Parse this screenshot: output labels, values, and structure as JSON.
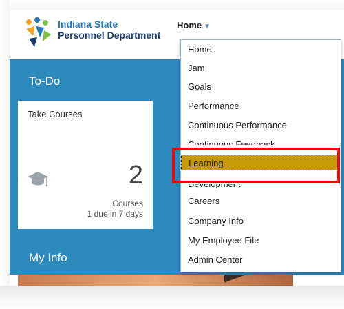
{
  "header": {
    "org_line1": "Indiana State",
    "org_line2": "Personnel Department",
    "home_label": "Home",
    "home_caret": "▼"
  },
  "todo": {
    "title": "To-Do",
    "card": {
      "title": "Take Courses",
      "icon": "graduation-cap-icon",
      "count": "2",
      "count_label": "Courses",
      "due_text": "1 due in 7 days"
    }
  },
  "myinfo": {
    "title": "My Info"
  },
  "menu": {
    "items": [
      "Home",
      "Jam",
      "Goals",
      "Performance",
      "Continuous Performance",
      "Continuous Feedback",
      "Learning",
      "Development",
      "Careers",
      "Company Info",
      "My Employee File",
      "Admin Center"
    ],
    "selected": "Learning"
  },
  "colors": {
    "band": "#2e89bf",
    "selected": "#c69a08",
    "annotation": "#e01010"
  }
}
